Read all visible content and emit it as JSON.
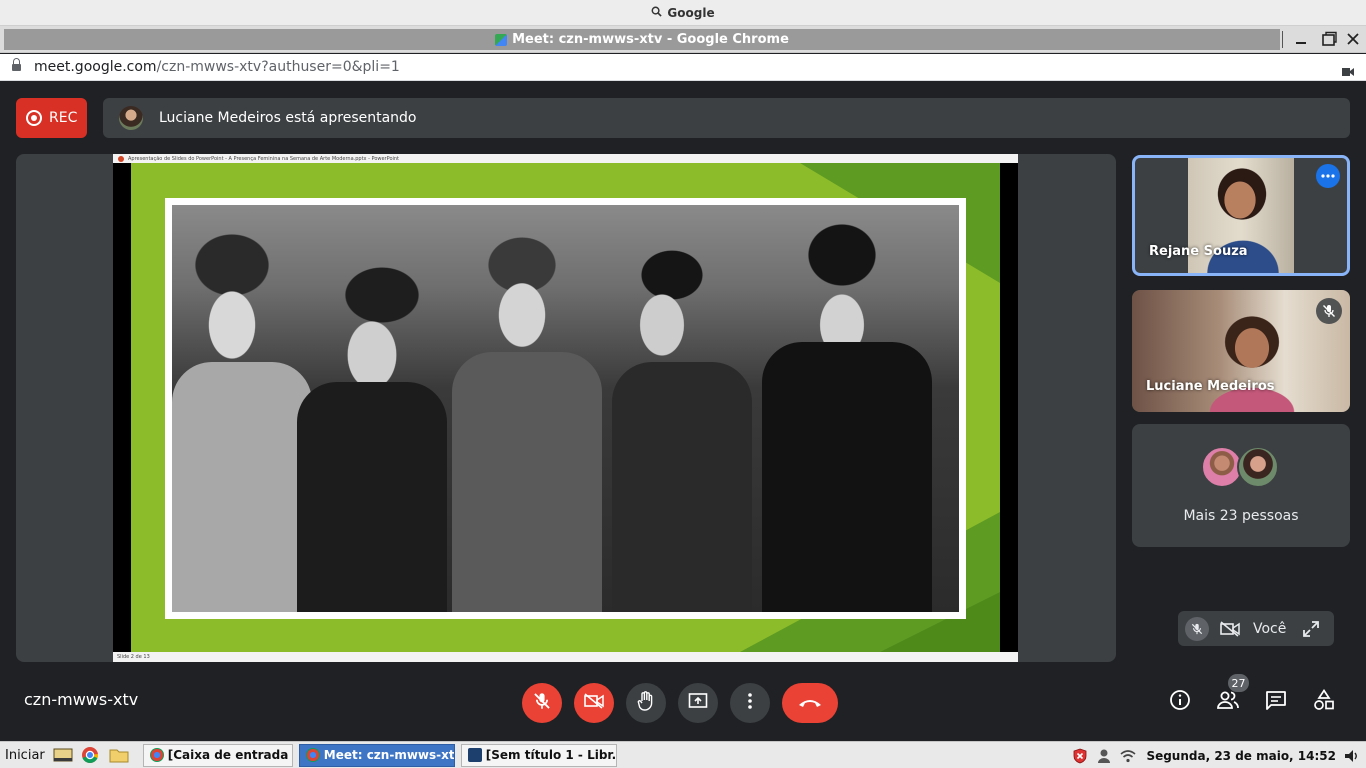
{
  "os": {
    "top_search_label": "Google"
  },
  "window": {
    "title": "Meet: czn-mwws-xtv - Google Chrome",
    "minimize_icon": "minimize-icon",
    "maximize_icon": "maximize-icon",
    "close_icon": "close-icon"
  },
  "address": {
    "host": "meet.google.com",
    "path": "/czn-mwws-xtv?authuser=0&pli=1"
  },
  "meet": {
    "rec_label": "REC",
    "presenting_text": "Luciane Medeiros está apresentando",
    "slide_window_title": "Apresentação de Slides do PowerPoint  -  A Presença Feminina na Semana de Arte Moderna.pptx  -  PowerPoint",
    "slide_status": "Slide 2 de 13",
    "participants": [
      {
        "name": "Rejane Souza"
      },
      {
        "name": "Luciane Medeiros"
      }
    ],
    "more_people": "Mais 23 pessoas",
    "self_label": "Você",
    "meeting_code": "czn-mwws-xtv",
    "participant_count": "27",
    "colors": {
      "accent_blue": "#8ab4f8",
      "danger_red": "#ea4335",
      "rec_red": "#d93025",
      "background": "#202124"
    }
  },
  "taskbar": {
    "start_label": "Iniciar",
    "tasks": [
      {
        "label": "[Caixa de entrada - ..."
      },
      {
        "label": "Meet: czn-mwws-xt..."
      },
      {
        "label": "[Sem título 1 - Libr..."
      }
    ],
    "clock": "Segunda, 23 de maio, 14:52"
  }
}
